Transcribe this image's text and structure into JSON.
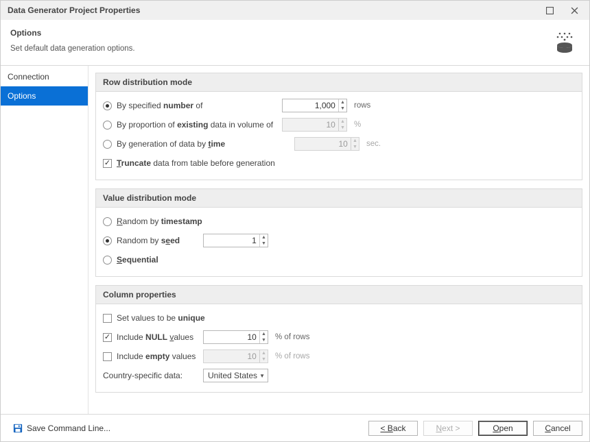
{
  "window": {
    "title": "Data Generator Project Properties"
  },
  "header": {
    "title": "Options",
    "description": "Set default data generation options."
  },
  "sidebar": {
    "items": [
      {
        "label": "Connection",
        "selected": false
      },
      {
        "label": "Options",
        "selected": true
      }
    ]
  },
  "groups": {
    "rowDist": {
      "title": "Row distribution mode",
      "byNumber": {
        "prefix": "By specified ",
        "bold": "number",
        "suffix": " of",
        "value": "1,000",
        "unit": "rows",
        "checked": true
      },
      "byProportion": {
        "prefix": "By proportion of ",
        "bold": "existing",
        "suffix": " data in volume of",
        "value": "10",
        "unit": "%",
        "checked": false
      },
      "byTime": {
        "prefix": "By generation of data by ",
        "bold": "time",
        "suffix": "",
        "value": "10",
        "unit": "sec.",
        "checked": false
      },
      "truncate": {
        "boldUnderline": "T",
        "bold": "runcate",
        "suffix": " data from table before generation",
        "checked": true
      }
    },
    "valueDist": {
      "title": "Value distribution mode",
      "randomTimestamp": {
        "underline": "R",
        "plain1": "andom by ",
        "bold": "timestamp",
        "checked": false
      },
      "randomSeed": {
        "plain1": "Random by s",
        "underline": "e",
        "plain2": "ed",
        "value": "1",
        "checked": true
      },
      "sequential": {
        "underline": "S",
        "bold": "equential",
        "checked": false
      }
    },
    "columnProps": {
      "title": "Column properties",
      "unique": {
        "prefix": "Set values to be ",
        "bold": "unique",
        "checked": false
      },
      "includeNull": {
        "prefix": "Include ",
        "bold": "NULL",
        "suffix1": " ",
        "underline": "v",
        "suffix2": "alues",
        "value": "10",
        "unit": "% of rows",
        "checked": true
      },
      "includeEmpty": {
        "prefix": "Include ",
        "bold": "empty",
        "suffix": " values",
        "value": "10",
        "unit": "% of rows",
        "checked": false
      },
      "country": {
        "label": "Country-specific data:",
        "value": "United States"
      }
    }
  },
  "footer": {
    "saveCmd": "Save Command Line...",
    "back": "< Back",
    "next": "Next >",
    "open": "Open",
    "cancel": "Cancel"
  }
}
